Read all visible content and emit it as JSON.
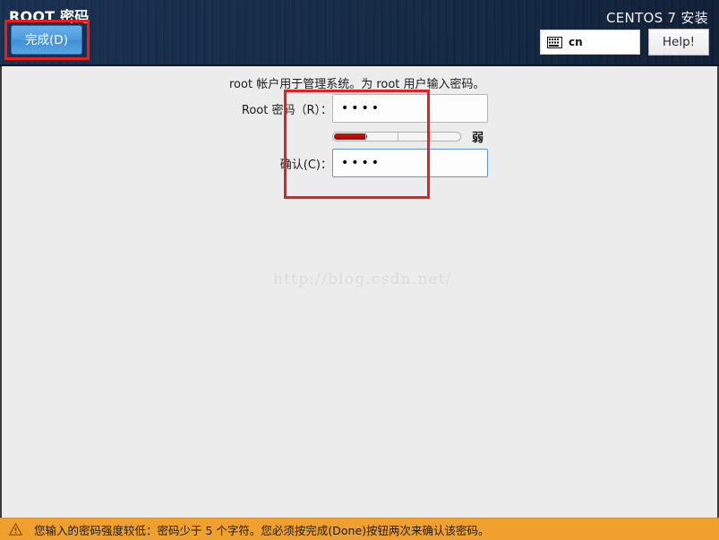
{
  "header": {
    "screen_title": "ROOT 密码",
    "done_label": "完成(D)",
    "brand": "CENTOS 7 安装",
    "keyboard_layout": "cn",
    "keyboard_icon": "keyboard-icon",
    "help_label": "Help!"
  },
  "main": {
    "intro": "root 帐户用于管理系统。为 root 用户输入密码。",
    "password_label": "Root 密码（R）：",
    "password_value": "••••",
    "confirm_label": "确认(C)：",
    "confirm_value": "••••",
    "strength": {
      "label": "弱",
      "fill_percent": 26,
      "segments": 4,
      "fill_color": "#b00808",
      "track_color": "#f4f4f4"
    },
    "watermark": "http://blog.csdn.net/"
  },
  "annotations": {
    "accent_color": "#ee1c1c",
    "done_box": "highlight-done-button",
    "fields_box": "highlight-password-fields"
  },
  "warning": {
    "icon": "warning-triangle-icon",
    "message": "您输入的密码强度较低：密码少于 5 个字符。您必须按完成(Done)按钮两次来确认该密码。",
    "background": "#efa02f"
  }
}
